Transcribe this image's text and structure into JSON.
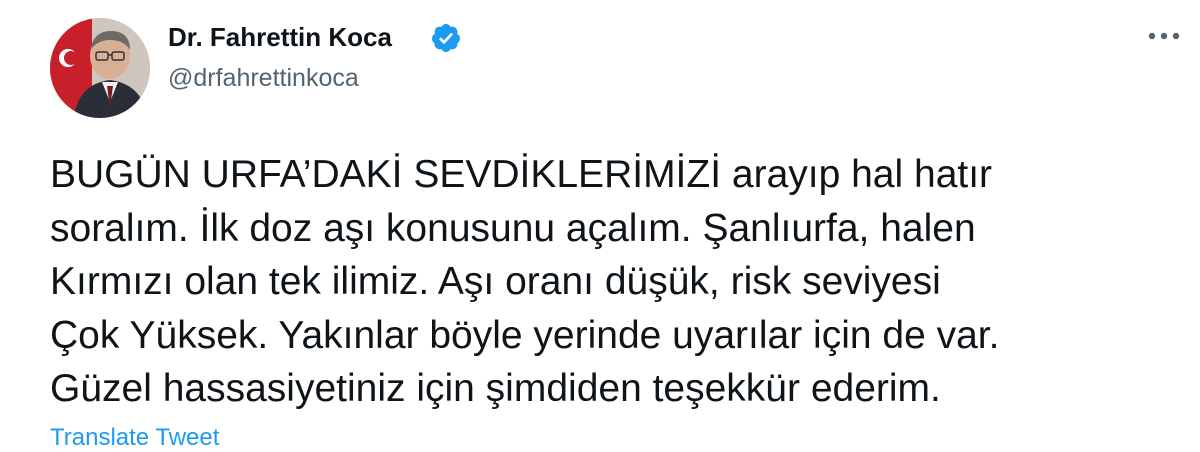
{
  "author": {
    "display_name": "Dr. Fahrettin Koca",
    "handle": "@drfahrettinkoca",
    "verified": true
  },
  "tweet": {
    "lines": [
      "BUGÜN URFA’DAKİ SEVDİKLERİMİZİ arayıp hal hatır",
      "soralım. İlk doz aşı konusunu açalım. Şanlıurfa, halen",
      "Kırmızı olan tek ilimiz. Aşı oranı düşük, risk seviyesi",
      "Çok Yüksek. Yakınlar böyle yerinde uyarılar için de var.",
      "Güzel hassasiyetiniz için şimdiden teşekkür ederim."
    ],
    "translate_label": "Translate Tweet"
  },
  "icons": {
    "verified": "verified-badge-icon",
    "more": "more-options-icon"
  },
  "colors": {
    "text": "#0f1419",
    "secondary_text": "#536471",
    "accent": "#1d9bf0"
  }
}
